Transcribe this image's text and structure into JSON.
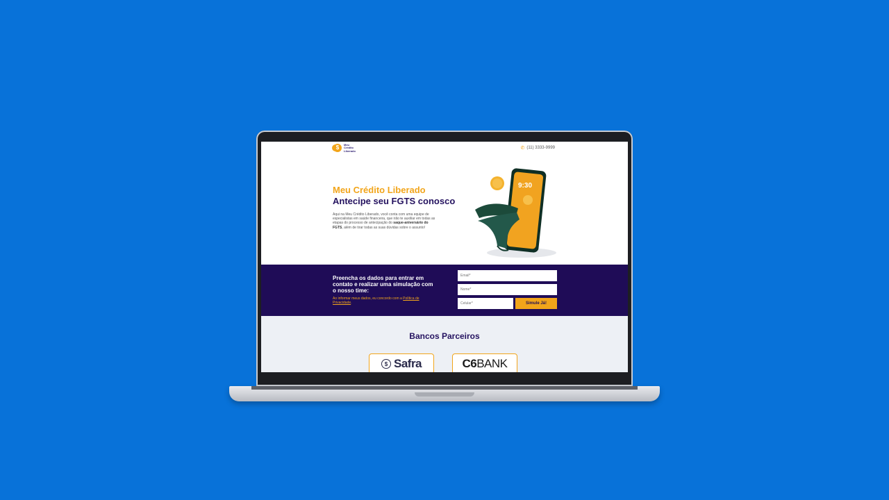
{
  "colors": {
    "background": "#0872d9",
    "brand_orange": "#f2a51a",
    "brand_navy": "#24125f",
    "form_band": "#1f0c57",
    "partners_bg": "#edf0f5"
  },
  "header": {
    "logo_lines": [
      "Meu",
      "Crédito",
      "Liberado"
    ],
    "logo_icon": "dollar-coin-icon",
    "phone_icon": "phone-icon",
    "phone": "(11) 3333-9999"
  },
  "hero": {
    "title_orange": "Meu Crédito Liberado",
    "title_navy": "Antecipe seu FGTS conosco",
    "body_pre": "Aqui na Meu Crédito Liberado, você conta com uma equipe de especialistas em saúde financeira, que irão te auxiliar em todas as etapas do processo de antecipação do ",
    "body_bold": "saque-aniversário do FGTS",
    "body_post": ", além de tirar todas as suas dúvidas sobre o assunto!",
    "phone_time": "9:30"
  },
  "form": {
    "title": "Preencha os dados para entrar em contato e realizar uma simulação com o nosso time:",
    "note_pre": "Ao informar meus dados, eu concordo com a ",
    "note_link": "Política de Privacidade",
    "note_post": ".",
    "email_placeholder": "Email*",
    "name_placeholder": "Nome*",
    "phone_placeholder": "Celular*",
    "submit_label": "Simule Já!"
  },
  "partners": {
    "title": "Bancos Parceiros",
    "banks": [
      {
        "name": "Safra",
        "icon": "safra-icon"
      },
      {
        "name_bold": "C6",
        "name_rest": "BANK"
      }
    ]
  }
}
